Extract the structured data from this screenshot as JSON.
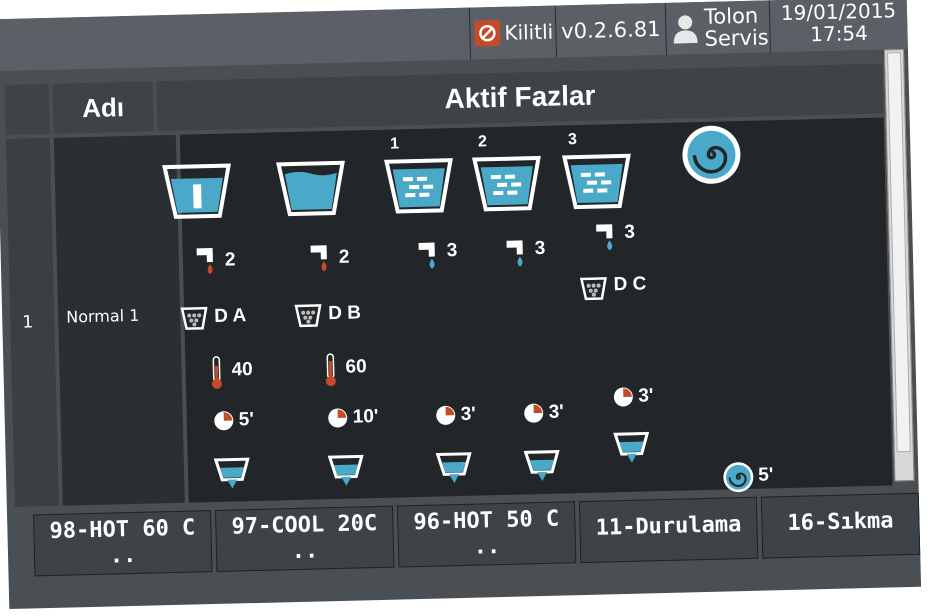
{
  "status_bar": {
    "lock_label": "Kilitli",
    "version": "v0.2.6.81",
    "user_line1": "Tolon",
    "user_line2": "Servis",
    "date": "19/01/2015",
    "time": "17:54"
  },
  "table": {
    "name_header": "Adı",
    "phases_header": "Aktif Fazlar",
    "row": {
      "number": "1",
      "name": "Normal 1"
    }
  },
  "phases": [
    {
      "basin_number": "",
      "water_count": "2",
      "detergent": "D A",
      "temperature": "40",
      "duration": "5'"
    },
    {
      "basin_number": "",
      "water_count": "2",
      "detergent": "D B",
      "temperature": "60",
      "duration": "10'"
    },
    {
      "basin_number": "1",
      "water_count": "3",
      "detergent": "",
      "temperature": "",
      "duration": "3'"
    },
    {
      "basin_number": "2",
      "water_count": "3",
      "detergent": "",
      "temperature": "",
      "duration": "3'"
    },
    {
      "basin_number": "3",
      "water_count": "3",
      "detergent": "D C",
      "temperature": "",
      "duration": "3'"
    }
  ],
  "spin": {
    "duration": "5'"
  },
  "tabs": [
    {
      "line1": "98-HOT 60 C",
      "line2": ".."
    },
    {
      "line1": "97-COOL 20C",
      "line2": ".."
    },
    {
      "line1": "96-HOT 50 C",
      "line2": ".."
    },
    {
      "line1": "11-Durulama",
      "line2": ""
    },
    {
      "line1": "16-Sıkma",
      "line2": ""
    }
  ],
  "colors": {
    "water": "#4aa8c8",
    "accent_red": "#c54a2a",
    "panel": "#232629"
  },
  "icons": [
    "lock-icon",
    "user-icon",
    "basin-icon",
    "faucet-icon",
    "detergent-icon",
    "thermometer-icon",
    "timer-icon",
    "drain-icon",
    "spin-icon"
  ]
}
